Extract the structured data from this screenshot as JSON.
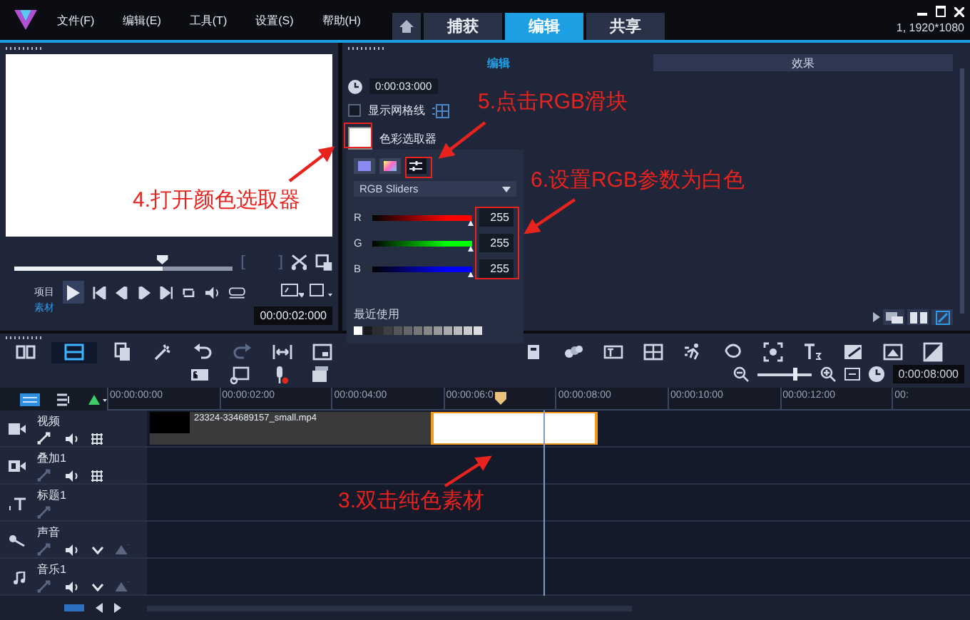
{
  "menu": [
    "文件(F)",
    "编辑(E)",
    "工具(T)",
    "设置(S)",
    "帮助(H)"
  ],
  "tabs": [
    {
      "label": "捕获",
      "selected": false
    },
    {
      "label": "编辑",
      "selected": true
    },
    {
      "label": "共享",
      "selected": false
    }
  ],
  "resolution": "1, 1920*1080",
  "preview": {
    "scrub": {
      "level": 0.68
    },
    "modes": [
      {
        "label": "项目",
        "selected": false
      },
      {
        "label": "素材",
        "selected": true
      }
    ],
    "timecode": "00:00:02:000"
  },
  "options": {
    "tabs": [
      {
        "label": "编辑",
        "selected": true
      },
      {
        "label": "效果",
        "selected": false
      }
    ],
    "duration": "0:00:03:000",
    "grid": {
      "label": "显示网格线",
      "checked": false
    },
    "color_picker": {
      "label": "色彩选取器",
      "color": "#ffffff"
    }
  },
  "color_popup": {
    "modes": [
      {
        "kind": "swatch",
        "selected": false
      },
      {
        "kind": "spectrum",
        "selected": false
      },
      {
        "kind": "sliders",
        "selected": true
      }
    ],
    "dropdown": "RGB Sliders",
    "channels": [
      {
        "name": "R",
        "color": "#ff0000",
        "level": 1,
        "value": "255"
      },
      {
        "name": "G",
        "color": "#00ff00",
        "level": 1,
        "value": "255"
      },
      {
        "name": "B",
        "color": "#0000ff",
        "level": 1,
        "value": "255"
      }
    ],
    "recent_label": "最近使用",
    "recent_colors": [
      {
        "color": "#ffffff"
      },
      {
        "color": "#1a1a1a"
      },
      {
        "color": "#2e2e2e"
      },
      {
        "color": "#404040"
      },
      {
        "color": "#555555"
      },
      {
        "color": "#666666"
      },
      {
        "color": "#777777"
      },
      {
        "color": "#888888"
      },
      {
        "color": "#999999"
      },
      {
        "color": "#aaaaaa"
      },
      {
        "color": "#bbbbbb"
      },
      {
        "color": "#cccccc"
      },
      {
        "color": "#dddddd"
      }
    ]
  },
  "timeline": {
    "zoom": {
      "level": 0.7
    },
    "duration": "0:00:08:000",
    "ruler": [
      "00:00:00:00",
      "00:00:02:00",
      "00:00:04:00",
      "00:00:06:0",
      "00:00:08:00",
      "00:00:10:00",
      "00:00:12:00",
      "00:"
    ],
    "tracks": [
      {
        "name": "视频",
        "kind": "video",
        "clips": [
          {
            "kind": "video",
            "name": "23324-334689157_small.mp4",
            "selected": false
          },
          {
            "kind": "color",
            "selected": true
          }
        ]
      },
      {
        "name": "叠加1",
        "kind": "overlay"
      },
      {
        "name": "标题1",
        "kind": "title"
      },
      {
        "name": "声音",
        "kind": "voice"
      },
      {
        "name": "音乐1",
        "kind": "music"
      }
    ]
  },
  "annotations": [
    {
      "text": "4.打开颜色选取器"
    },
    {
      "text": "5.点击RGB滑块"
    },
    {
      "text": "6.设置RGB参数为白色"
    },
    {
      "text": "3.双击纯色素材"
    }
  ]
}
